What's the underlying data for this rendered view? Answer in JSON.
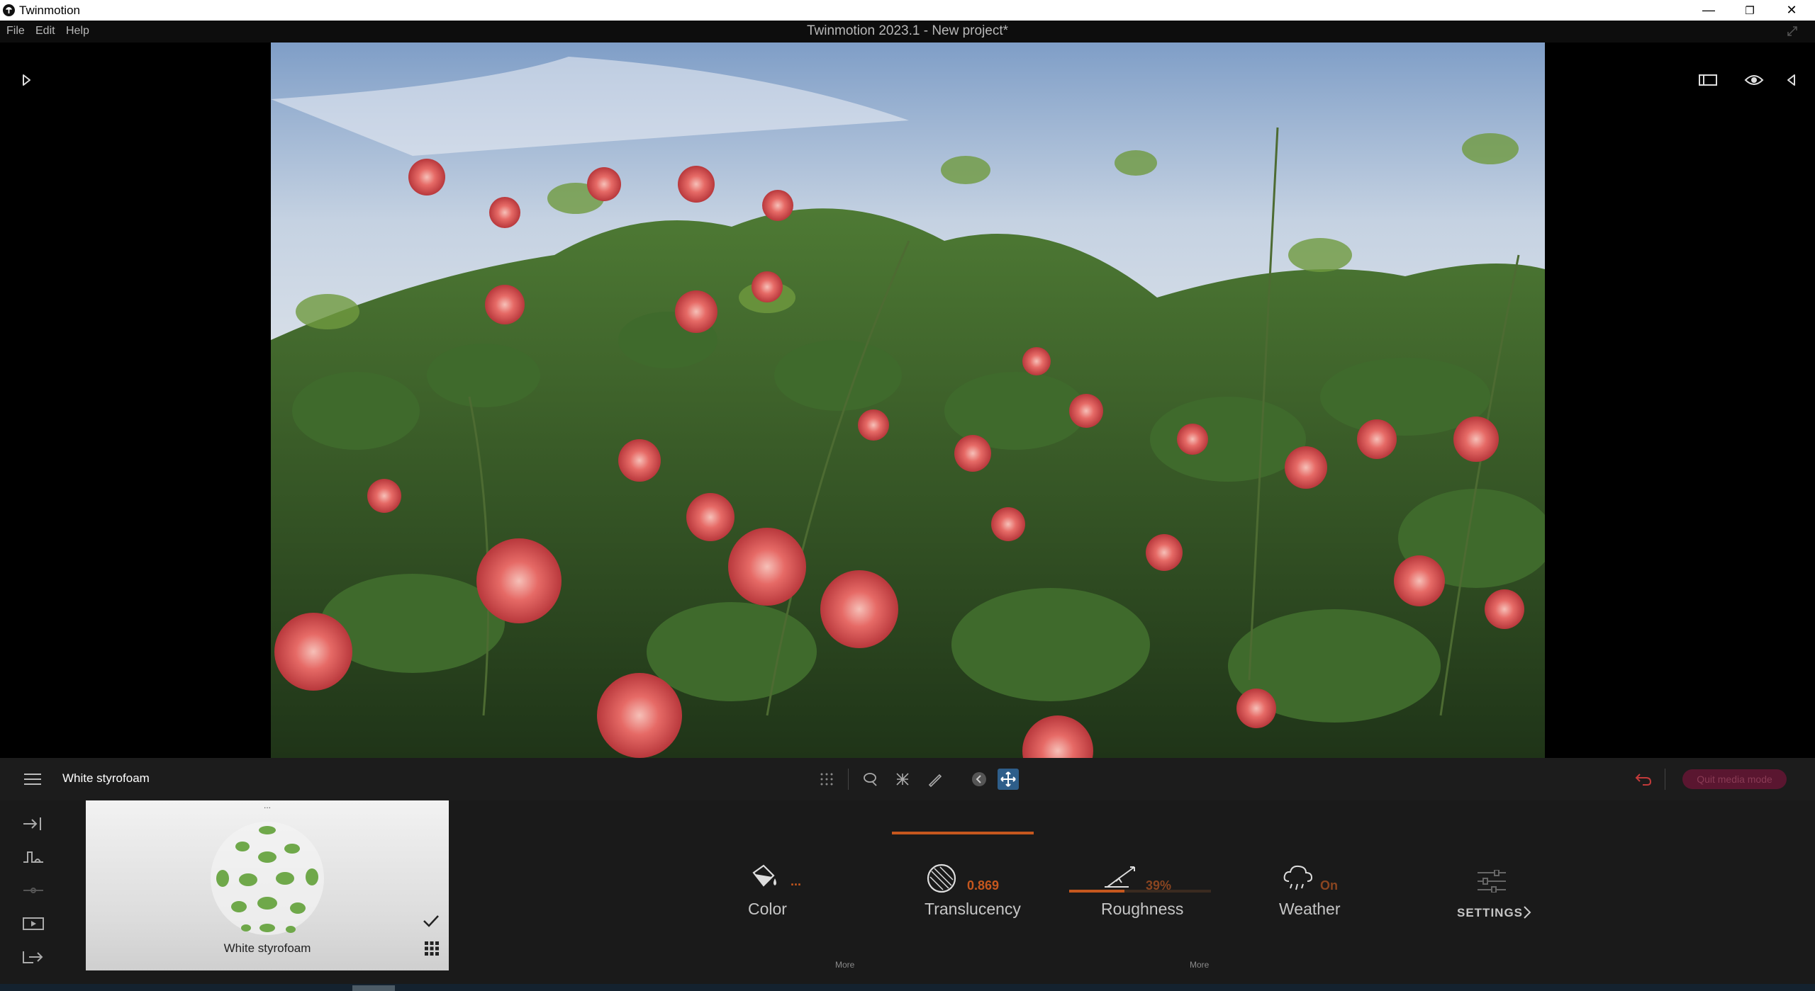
{
  "window": {
    "app_name": "Twinmotion",
    "document_title": "Twinmotion 2023.1 - New project*",
    "controls": {
      "minimize": "—",
      "restore": "❐",
      "close": "✕"
    }
  },
  "menu": [
    {
      "label": "File"
    },
    {
      "label": "Edit"
    },
    {
      "label": "Help"
    }
  ],
  "viewport": {
    "scene_description_icon": "photo-viewport",
    "right_icons": [
      "layout-icon",
      "eye-icon",
      "collapse-left-icon"
    ],
    "left_icons": [
      "expand-right-icon"
    ]
  },
  "toolbar": {
    "panel_title": "White styrofoam",
    "tools": [
      "grid-icon",
      "lasso-select-icon",
      "fence-select-icon",
      "eyedropper-icon",
      "back-circle-icon",
      "move-icon"
    ],
    "active_tool": "move-icon",
    "undo_icon": "undo-icon",
    "quit_media_mode": "Quit media mode"
  },
  "panel": {
    "left_rail_icons": [
      "import-icon",
      "context-icon",
      "path-icon",
      "media-icon",
      "export-icon"
    ],
    "thumbnail": {
      "label": "White styrofoam",
      "top_marker": "...",
      "checkmark_icon": "check-icon",
      "library_icon": "grid-library-icon"
    },
    "properties": [
      {
        "key": "color",
        "label": "Color",
        "value": "...",
        "icon": "paint-bucket-icon"
      },
      {
        "key": "translucency",
        "label": "Translucency",
        "value": "0.869",
        "icon": "translucency-sphere-icon"
      },
      {
        "key": "roughness",
        "label": "Roughness",
        "value": "39%",
        "icon": "roughness-icon",
        "level": 0.39
      },
      {
        "key": "weather",
        "label": "Weather",
        "value": "On",
        "icon": "weather-icon"
      }
    ],
    "settings": {
      "label": "SETTINGS",
      "icon": "sliders-icon"
    },
    "more_links": [
      "More",
      "More"
    ]
  },
  "colors": {
    "accent_orange": "#c5571e",
    "active_tool_blue": "#2e5e8a",
    "quit_button": "#5a1630",
    "undo_red": "#c23a3a"
  }
}
